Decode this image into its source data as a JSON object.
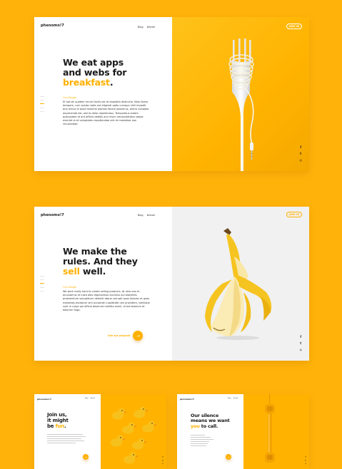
{
  "brand": {
    "logo": "phenomo!7",
    "accent_color": "#FFB000",
    "background_color": "#FFB30A"
  },
  "nav": {
    "items": [
      "Blog",
      "#forall"
    ],
    "join_label": "JOIN US"
  },
  "social_icons": [
    "facebook-icon",
    "twitter-icon",
    "instagram-icon"
  ],
  "screen1": {
    "headline_line1": "We eat apps",
    "headline_line2": "and webs for",
    "headline_accent": "breakfast",
    "headline_end": ".",
    "subheading": "Our Design",
    "body": "Et harum quidem rerum facilis est et expedita distinctio. Nam libero tempore, cum soluta nobis est eligendi optio cumque nihil impedit quo minus id quod maxime placeat facere possimus, omnis voluptas assumenda est, omnis dolor repellendus. Temporibus autem quibusdam et aut officiis debitis aut rerum necessitatibus saepe eveniet ut et voluptates repudiandae sint et molestiae non recusandae."
  },
  "screen2": {
    "headline_line1": "We make the",
    "headline_line2": "rules. And they",
    "headline_accent": "sell",
    "headline_end": " well.",
    "subheading": "Our Design",
    "body": "We work really hard to create selling products. At vero eos et accusamus et iusto odio dignissimos ducimus qui blanditiis praesentium voluptatum deleniti atque corrupti quos dolores et quas molestias excepturi sint occaecati cupiditate non provident, similique sunt in culpa qui officia deserunt mollitia animi, id est laborum et dolorum fuga.",
    "cta_label": "See our projects",
    "cta_arrow": "→"
  },
  "screen3": {
    "logo": "phenomo!7",
    "nav": [
      "Blog",
      "#forall"
    ],
    "headline_line1": "Join us,",
    "headline_line2": "it might",
    "headline_line3": "be",
    "headline_accent": "fun",
    "headline_end": "."
  },
  "screen4": {
    "logo": "phenomo!7",
    "nav": [
      "Blog",
      "#forall"
    ],
    "headline_line1": "Our silence",
    "headline_line2": "means we want",
    "headline_accent": "you",
    "headline_end": " to call."
  }
}
